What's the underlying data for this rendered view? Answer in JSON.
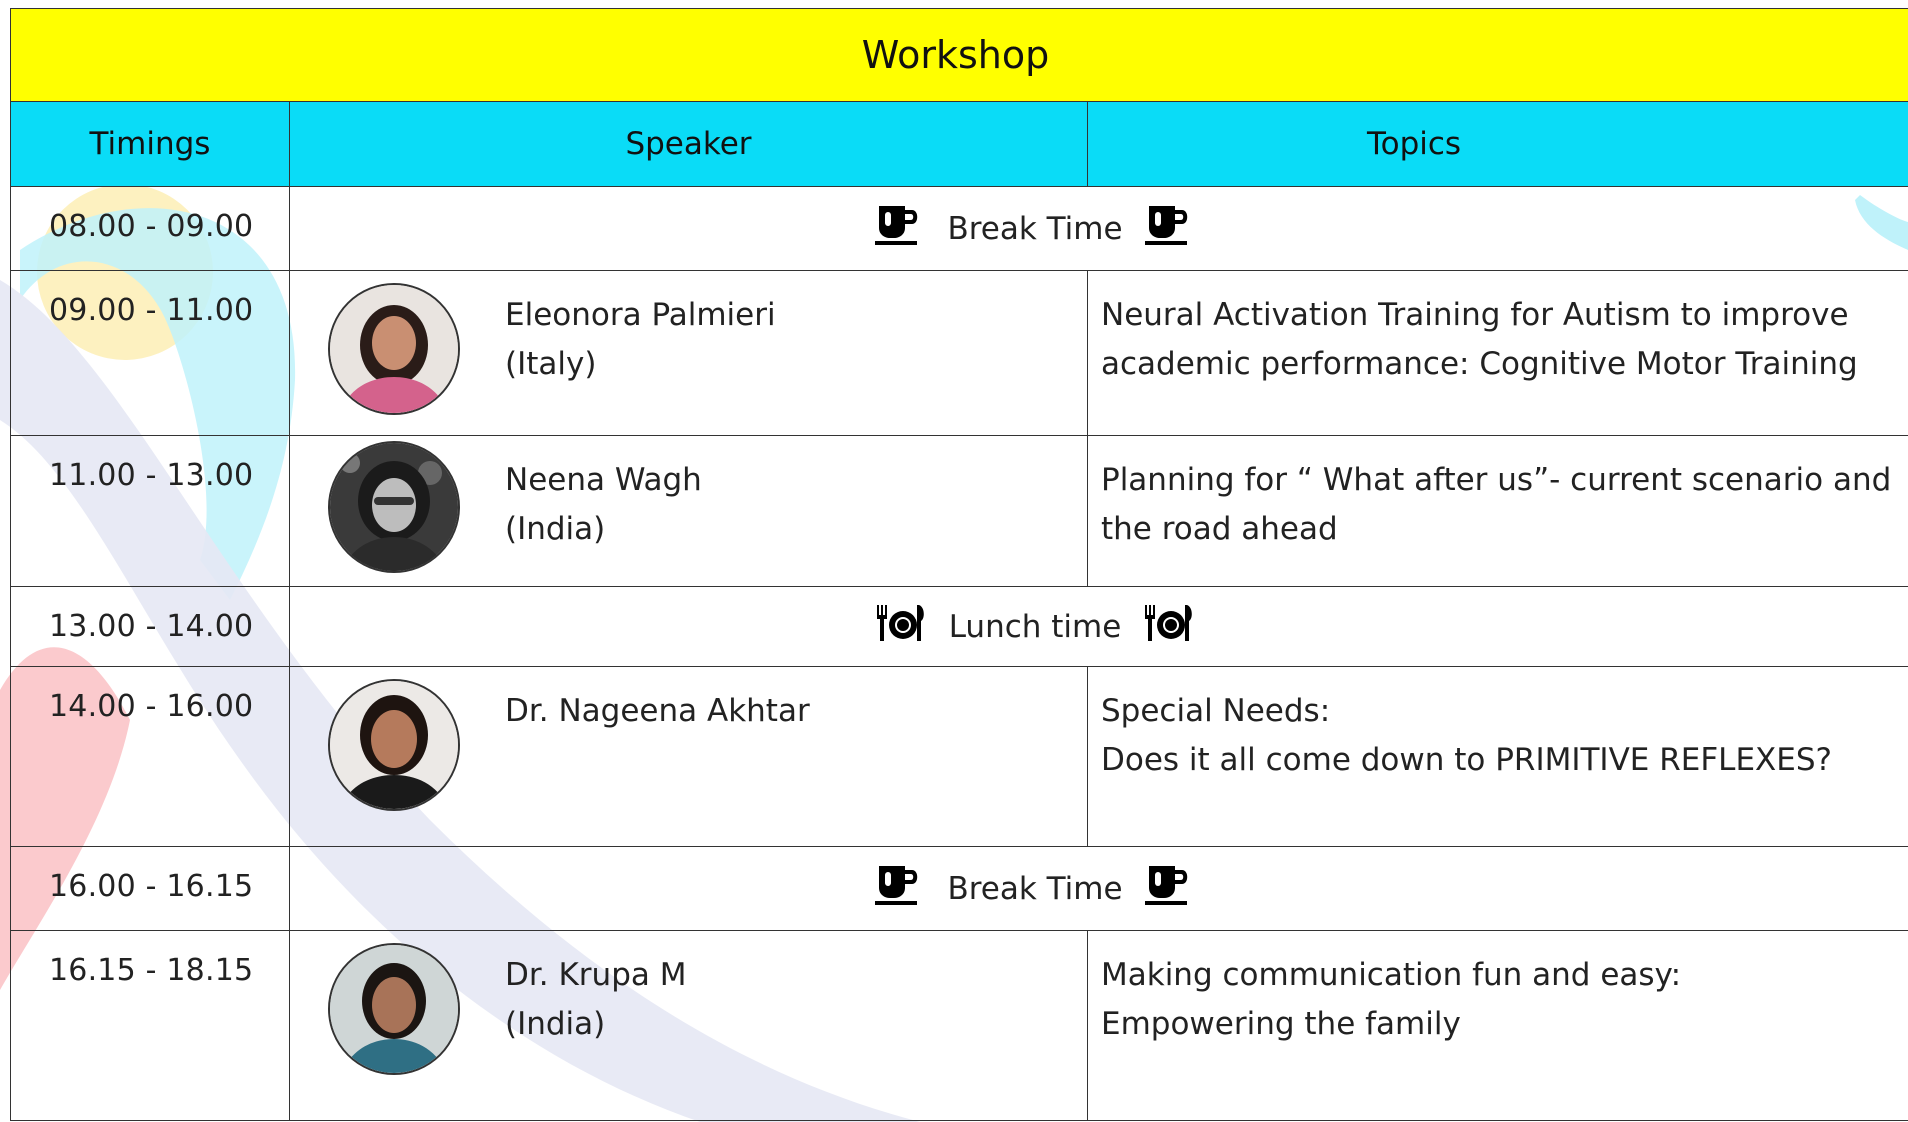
{
  "title": "Workshop",
  "headers": {
    "timings": "Timings",
    "speaker": "Speaker",
    "topics": "Topics"
  },
  "rows": [
    {
      "type": "break",
      "time": "08.00 - 09.00",
      "label": "Break Time",
      "icon": "coffee-cup-icon"
    },
    {
      "type": "session",
      "time": "09.00 - 11.00",
      "name": "Eleonora Palmieri",
      "country": "(Italy)",
      "topic_line1": "Neural Activation Training for Autism to improve",
      "topic_line2": "academic performance: Cognitive Motor Training"
    },
    {
      "type": "session",
      "time": "11.00 - 13.00",
      "name": "Neena Wagh",
      "country": "(India)",
      "topic_line1": "Planning for “ What after us”- current scenario and",
      "topic_line2": "the road ahead"
    },
    {
      "type": "break",
      "time": "13.00 - 14.00",
      "label": "Lunch time",
      "icon": "dinner-plate-icon"
    },
    {
      "type": "session",
      "time": "14.00 - 16.00",
      "name": "Dr. Nageena Akhtar",
      "country": "",
      "topic_line1": "Special Needs:",
      "topic_line2": "Does it all come down to PRIMITIVE REFLEXES?"
    },
    {
      "type": "break",
      "time": "16.00 - 16.15",
      "label": "Break Time",
      "icon": "coffee-cup-icon"
    },
    {
      "type": "session",
      "time": "16.15 - 18.15",
      "name": "Dr. Krupa M",
      "country": "(India)",
      "topic_line1": "Making communication fun and easy:",
      "topic_line2": "Empowering the family"
    }
  ],
  "colors": {
    "title_bg": "#ffff00",
    "header_bg": "#0adcf7",
    "decor_yellow": "#fdeeb0",
    "decor_cyan": "#bff2fa",
    "decor_red": "#fbc4c8",
    "decor_lavender": "#e6e8f4"
  }
}
